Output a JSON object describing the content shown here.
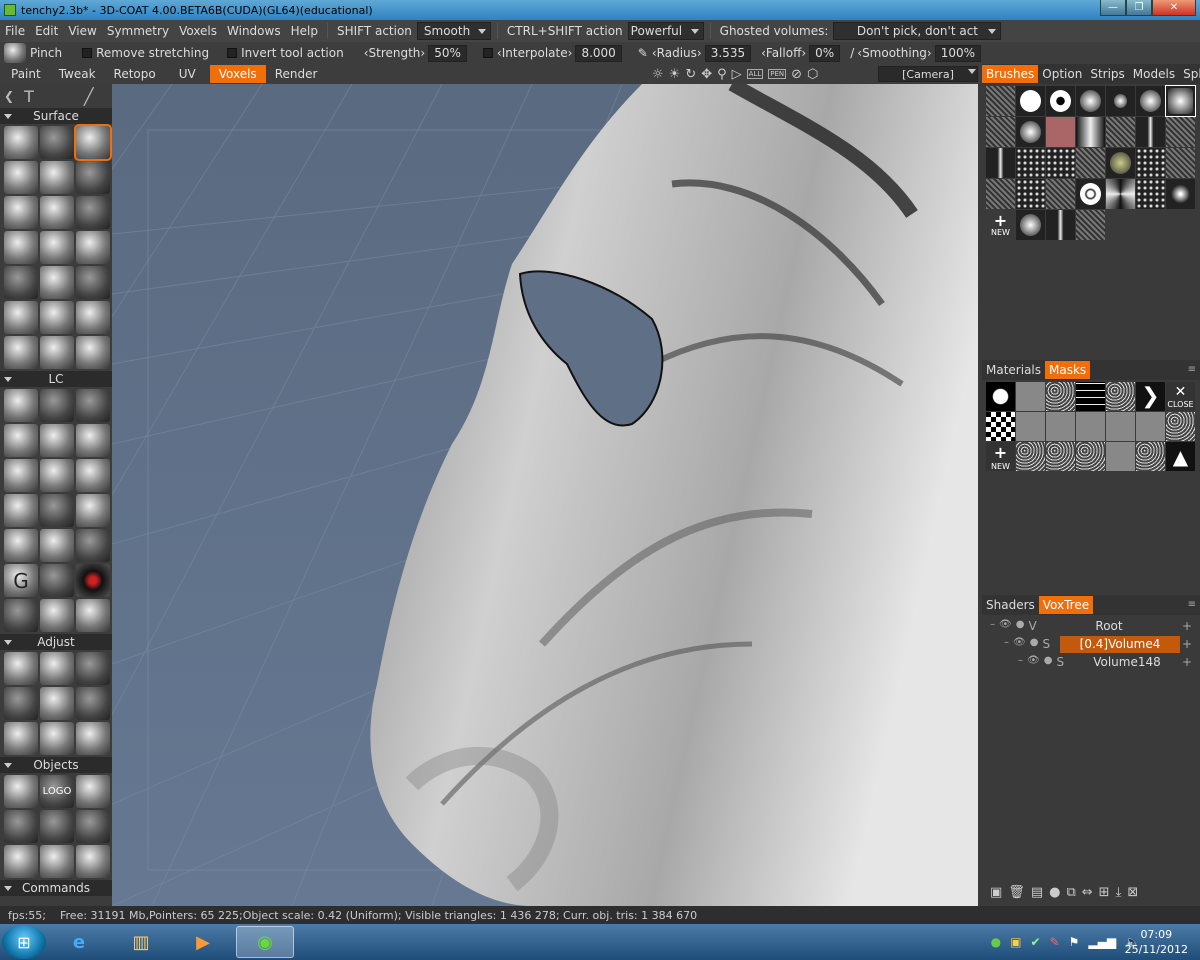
{
  "window": {
    "title": "tenchy2.3b* - 3D-COAT 4.00.BETA6B(CUDA)(GL64)(educational)"
  },
  "menu": {
    "items": [
      "File",
      "Edit",
      "View",
      "Symmetry",
      "Voxels",
      "Windows",
      "Help"
    ],
    "shift_label": "SHIFT action",
    "shift_value": "Smooth",
    "ctrlshift_label": "CTRL+SHIFT action",
    "ctrlshift_value": "Powerful",
    "ghosted_label": "Ghosted volumes:",
    "ghosted_value": "Don't pick, don't act"
  },
  "toolbar": {
    "tool_name": "Pinch",
    "remove_stretching": "Remove stretching",
    "invert_tool": "Invert tool action",
    "strength_label": "Strength",
    "strength_value": "50%",
    "interpolate_label": "Interpolate",
    "interpolate_value": "8.000",
    "radius_label": "Radius",
    "radius_value": "3.535",
    "falloff_label": "Falloff",
    "falloff_value": "0%",
    "smoothing_label": "Smoothing",
    "smoothing_value": "100%"
  },
  "modes": {
    "tabs": [
      "Paint",
      "Tweak",
      "Retopo",
      "UV",
      "Voxels",
      "Render"
    ],
    "active_index": 4,
    "camera": "[Camera]",
    "view_icon_all": "ALL",
    "view_icon_pen": "PEN"
  },
  "left_panel": {
    "sections": {
      "surface": "Surface",
      "lc": "LC",
      "adjust": "Adjust",
      "objects": "Objects",
      "commands": "Commands"
    },
    "logo_tool": "LOGO",
    "g_tool": "G"
  },
  "brushes_panel": {
    "tabs": [
      "Brushes",
      "Option",
      "Strips",
      "Models",
      "Spline"
    ],
    "active_index": 0,
    "new_label": "NEW"
  },
  "materials_panel": {
    "tabs": [
      "Materials",
      "Masks"
    ],
    "active_index": 1,
    "close_label": "CLOSE",
    "new_label": "NEW"
  },
  "voxtree_panel": {
    "tabs": [
      "Shaders",
      "VoxTree"
    ],
    "active_index": 1,
    "rows": [
      {
        "type": "V",
        "name": "Root",
        "active": false
      },
      {
        "type": "S",
        "name": "[0.4]Volume4",
        "active": true
      },
      {
        "type": "S",
        "name": "Volume148",
        "active": false
      }
    ]
  },
  "status": {
    "fps": "fps:55;",
    "info": "Free: 31191 Mb,Pointers: 65 225;Object scale: 0.42 (Uniform); Visible triangles: 1 436 278; Curr. obj. tris: 1 384 670"
  },
  "taskbar": {
    "time": "07:09",
    "date": "25/11/2012"
  },
  "colors": {
    "accent": "#ee6f0b",
    "viewport_bg": "#5f6f86",
    "panel": "#3c3c3c"
  }
}
